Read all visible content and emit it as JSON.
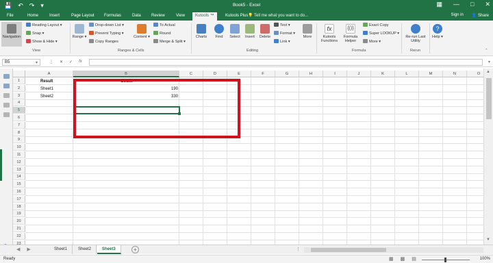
{
  "titlebar": {
    "title": "Book5 - Excel",
    "qat": {
      "save_icon": "save-icon",
      "undo_icon": "undo-icon",
      "redo_icon": "redo-icon",
      "customize_icon": "chevron-down-icon"
    }
  },
  "tabs": [
    "File",
    "Home",
    "Insert",
    "Page Layout",
    "Formulas",
    "Data",
    "Review",
    "View",
    "Kutools ™",
    "Kutools Plus"
  ],
  "active_tab": "Kutools ™",
  "tell_me": "Tell me what you want to do...",
  "signin": "Sign in",
  "share": "Share",
  "ribbon": {
    "navigation": "Navigation",
    "view_group": "View",
    "reading_layout": "Reading Layout",
    "snap": "Snap",
    "show_hide": "Show & Hide",
    "range": "Range",
    "dropdown_list": "Drop-down List",
    "prevent_typing": "Prevent Typing",
    "copy_ranges": "Copy Ranges",
    "ranges_cells_group": "Ranges & Cells",
    "content": "Content",
    "to_actual": "To Actual",
    "round": "Round",
    "merge_split": "Merge & Split",
    "charts": "Charts",
    "find": "Find",
    "select": "Select",
    "insert": "Insert",
    "delete": "Delete",
    "text": "Text",
    "format": "Format",
    "link": "Link",
    "more": "More",
    "editing_group": "Editing",
    "kutools_functions": "Kutools Functions",
    "formula_helper": "Formula Helper",
    "exact_copy": "Exact Copy",
    "super_lookup": "Super LOOKUP",
    "more2": "More",
    "formula_group": "Formula",
    "rerun": "Re-run Last Utility",
    "rerun_group": "Rerun",
    "help": "Help"
  },
  "formula_bar": {
    "name_box": "B5",
    "fx": "fx",
    "value": ""
  },
  "columns": [
    "A",
    "B",
    "C",
    "D",
    "E",
    "F",
    "G",
    "H",
    "I",
    "J",
    "K",
    "L",
    "M",
    "N",
    "O"
  ],
  "rows": [
    "1",
    "2",
    "3",
    "4",
    "5",
    "6",
    "7",
    "8",
    "9",
    "10",
    "11",
    "12",
    "13",
    "14",
    "15",
    "16",
    "17",
    "18",
    "19",
    "20",
    "21",
    "22",
    "23"
  ],
  "cells": {
    "A1": "Result",
    "B1": "Count",
    "A2": "Sheet1",
    "B2": "190",
    "A3": "Sheet2",
    "B3": "330"
  },
  "sheets": [
    "Sheet1",
    "Sheet2",
    "Sheet3"
  ],
  "active_sheet": "Sheet3",
  "status": {
    "ready": "Ready",
    "zoom": "100%"
  },
  "colors": {
    "excel_green": "#217346",
    "highlight_red": "#d0141d"
  }
}
